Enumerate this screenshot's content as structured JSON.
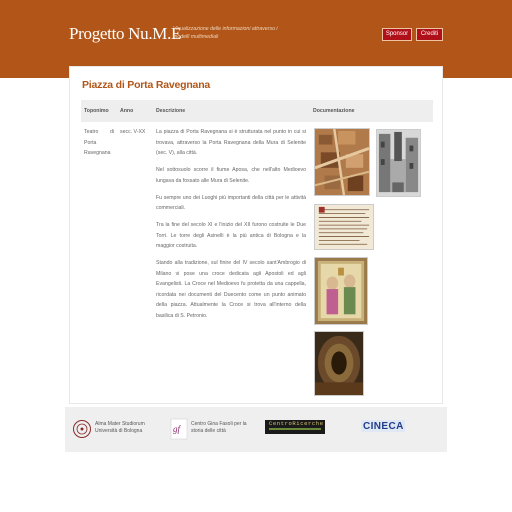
{
  "header": {
    "logo": "Progetto Nu.M.E",
    "tagline": "Visualizzazione delle informazioni attraverso i modelli multimediali",
    "sponsor_label": "Sponsor",
    "credits_label": "Crediti",
    "bg_color": "#b15618"
  },
  "main": {
    "title": "Piazza di Porta Ravegnana",
    "columns": [
      "Toponimo",
      "Anno",
      "Descrizione",
      "Documentazione"
    ],
    "row": {
      "toponimo": "Teatro di Porta Ravegnana",
      "anno": "secc. V-XX",
      "paragraphs": [
        "La piazza di Porta Ravegnana si è strutturata nel punto in cui si trovava, attraverso la Porta Ravegnana della Mura di Selenite (sec. V), alla città.",
        "Nel sottosuolo scorre il fiume Aposa, che nell'alto Medioevo lungava da fossato alle Mura di Selenite.",
        "Fu sempre uno dei Luoghi più importanti della città per le attività commerciali.",
        "Tra la fine del secolo XI e l'inizio del XII furono costruite le Due Torri. Le torre degli Asinelli è la più antica di Bologna e la maggior costruita.",
        "Stando alla tradizione, sul finire del IV secolo sant'Ambrogio di Milano vi pose una croce dedicata agli Apostoli ed agli Evangelisti. La Croce nel Medioevo fu protetta da una cappella, ricordata nei documenti del Duecento come un punto animato della piazza. Attualmente la Croce si trova all'interno della basilica di S. Petronio."
      ]
    },
    "documentation_images": [
      "aerial-map-thumbnail",
      "old-street-photo-thumbnail",
      "manuscript-page-thumbnail",
      "painting-thumbnail",
      "underground-tunnel-thumbnail"
    ]
  },
  "footer": {
    "partners": [
      {
        "name": "Alma Mater Studiorum Università di Bologna"
      },
      {
        "name": "Centro Gina Fasoli per la storia delle città"
      },
      {
        "name": "CentroRicerche"
      },
      {
        "name": "CINECA"
      }
    ]
  }
}
